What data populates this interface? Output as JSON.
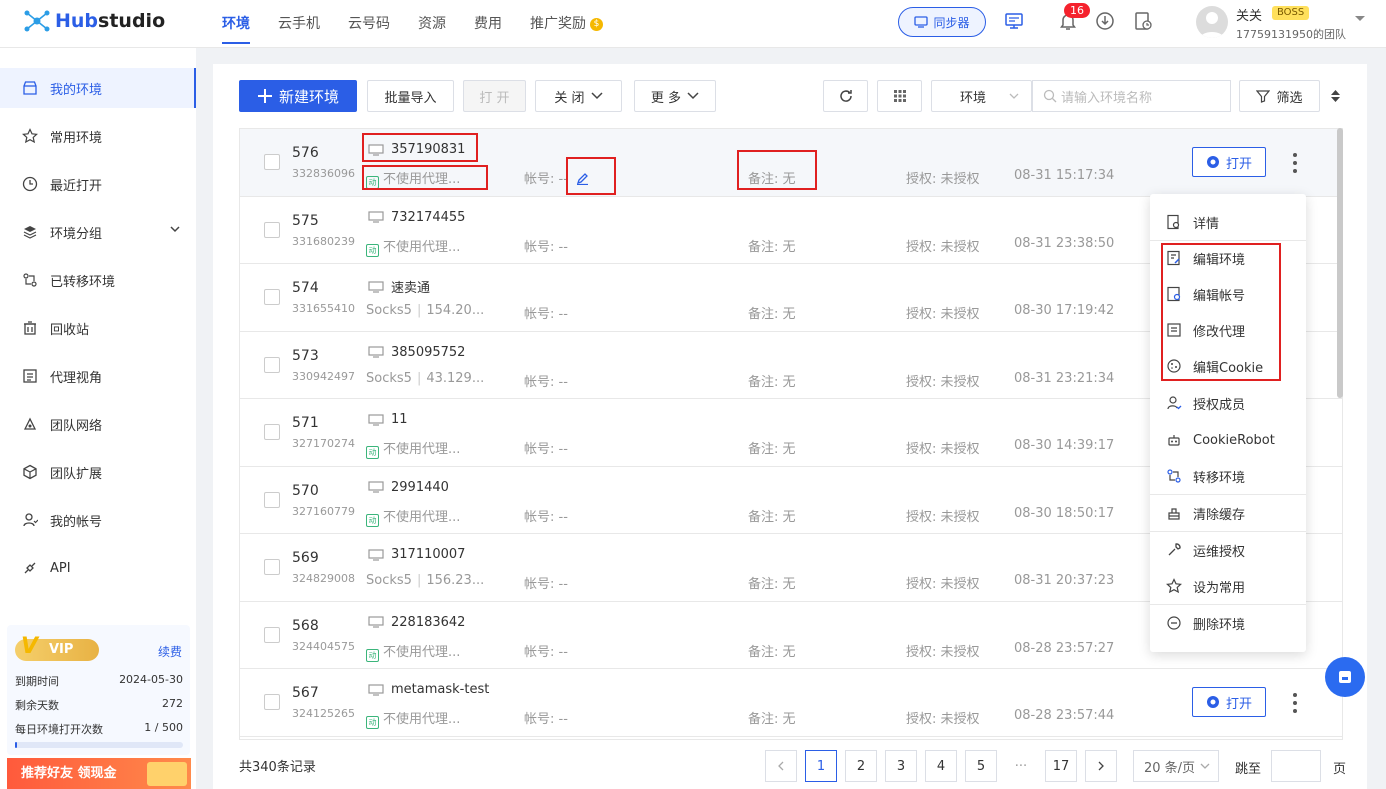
{
  "app": {
    "name_prefix": "Hub",
    "name_suffix": "studio"
  },
  "nav": [
    {
      "label": "环境",
      "active": true
    },
    {
      "label": "云手机"
    },
    {
      "label": "云号码"
    },
    {
      "label": "资源"
    },
    {
      "label": "费用"
    },
    {
      "label": "推广奖励"
    }
  ],
  "header": {
    "sync_label": "同步器",
    "notif_count": "16",
    "user_name": "关关",
    "user_badge": "BOSS",
    "team": "17759131950的团队"
  },
  "sidebar": {
    "items": [
      {
        "label": "我的环境",
        "icon": "shop-icon"
      },
      {
        "label": "常用环境",
        "icon": "star-icon"
      },
      {
        "label": "最近打开",
        "icon": "clock-icon"
      },
      {
        "label": "环境分组",
        "icon": "layers-icon"
      },
      {
        "label": "已转移环境",
        "icon": "transfer-icon"
      },
      {
        "label": "回收站",
        "icon": "trash-icon"
      },
      {
        "label": "代理视角",
        "icon": "proxy-icon"
      },
      {
        "label": "团队网络",
        "icon": "network-icon"
      },
      {
        "label": "团队扩展",
        "icon": "cube-icon"
      },
      {
        "label": "我的帐号",
        "icon": "user-icon"
      },
      {
        "label": "API",
        "icon": "api-icon"
      }
    ],
    "vip": {
      "badge": "VIP",
      "renew": "续费",
      "rows": [
        {
          "label": "到期时间",
          "value": "2024-05-30"
        },
        {
          "label": "剩余天数",
          "value": "272"
        },
        {
          "label": "每日环境打开次数",
          "value": "1 / 500"
        }
      ],
      "usage_fraction": 0.002
    },
    "promo": "推荐好友 领现金"
  },
  "toolbar": {
    "new_env": "新建环境",
    "batch_import": "批量导入",
    "open": "打 开",
    "close": "关 闭",
    "more": "更 多",
    "env_select": "环境",
    "search_placeholder": "请输入环境名称",
    "filter": "筛选"
  },
  "rows": [
    {
      "seq": "576",
      "id": "332836096",
      "name": "357190831",
      "proxy_type": "none",
      "proxy": "不使用代理...",
      "account": "帐号: --",
      "note": "备注: 无",
      "auth": "授权: 未授权",
      "time": "08-31 15:17:34"
    },
    {
      "seq": "575",
      "id": "331680239",
      "name": "732174455",
      "proxy_type": "none",
      "proxy": "不使用代理...",
      "account": "帐号: --",
      "note": "备注: 无",
      "auth": "授权: 未授权",
      "time": "08-31 23:38:50"
    },
    {
      "seq": "574",
      "id": "331655410",
      "name": "速卖通",
      "proxy_type": "socks",
      "proxy_label": "Socks5",
      "proxy": "154.20...",
      "account": "帐号: --",
      "note": "备注: 无",
      "auth": "授权: 未授权",
      "time": "08-30 17:19:42"
    },
    {
      "seq": "573",
      "id": "330942497",
      "name": "385095752",
      "proxy_type": "socks",
      "proxy_label": "Socks5",
      "proxy": "43.129...",
      "account": "帐号: --",
      "note": "备注: 无",
      "auth": "授权: 未授权",
      "time": "08-31 23:21:34"
    },
    {
      "seq": "571",
      "id": "327170274",
      "name": "11",
      "proxy_type": "none",
      "proxy": "不使用代理...",
      "account": "帐号: --",
      "note": "备注: 无",
      "auth": "授权: 未授权",
      "time": "08-30 14:39:17"
    },
    {
      "seq": "570",
      "id": "327160779",
      "name": "2991440",
      "proxy_type": "none",
      "proxy": "不使用代理...",
      "account": "帐号: --",
      "note": "备注: 无",
      "auth": "授权: 未授权",
      "time": "08-30 18:50:17"
    },
    {
      "seq": "569",
      "id": "324829008",
      "name": "317110007",
      "proxy_type": "socks",
      "proxy_label": "Socks5",
      "proxy": "156.23...",
      "account": "帐号: --",
      "note": "备注: 无",
      "auth": "授权: 未授权",
      "time": "08-31 20:37:23"
    },
    {
      "seq": "568",
      "id": "324404575",
      "name": "228183642",
      "proxy_type": "none",
      "proxy": "不使用代理...",
      "account": "帐号: --",
      "note": "备注: 无",
      "auth": "授权: 未授权",
      "time": "08-28 23:57:27"
    },
    {
      "seq": "567",
      "id": "324125265",
      "name": "metamask-test",
      "proxy_type": "none",
      "proxy": "不使用代理...",
      "account": "帐号: --",
      "note": "备注: 无",
      "auth": "授权: 未授权",
      "time": "08-28 23:57:44"
    }
  ],
  "row_open_label": "打开",
  "menu": [
    {
      "label": "详情",
      "icon": "detail-icon"
    },
    {
      "label": "编辑环境",
      "icon": "edit-env-icon"
    },
    {
      "label": "编辑帐号",
      "icon": "edit-account-icon"
    },
    {
      "label": "修改代理",
      "icon": "proxy-edit-icon"
    },
    {
      "label": "编辑Cookie",
      "icon": "cookie-icon"
    },
    {
      "label": "授权成员",
      "icon": "member-icon"
    },
    {
      "label": "CookieRobot",
      "icon": "robot-icon"
    },
    {
      "label": "转移环境",
      "icon": "transfer-icon"
    },
    {
      "label": "清除缓存",
      "icon": "clear-cache-icon"
    },
    {
      "label": "运维授权",
      "icon": "wrench-icon"
    },
    {
      "label": "设为常用",
      "icon": "star-icon"
    },
    {
      "label": "删除环境",
      "icon": "delete-icon"
    }
  ],
  "footer": {
    "total": "共340条记录",
    "pages": [
      "1",
      "2",
      "3",
      "4",
      "5",
      "···",
      "17"
    ],
    "page_size": "20 条/页",
    "goto": "跳至",
    "page_unit": "页"
  },
  "colors": {
    "accent": "#2b5ee6",
    "annotation": "#e02020"
  }
}
